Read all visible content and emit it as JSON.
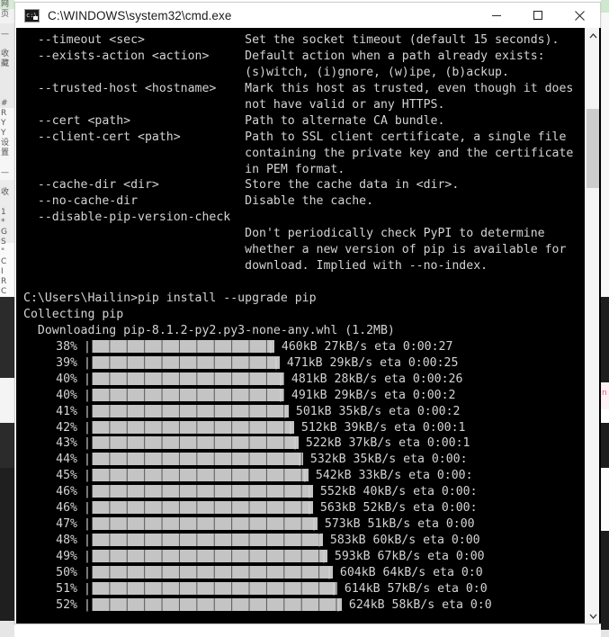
{
  "window": {
    "title": "C:\\WINDOWS\\system32\\cmd.exe",
    "icon": "cmd-console-icon",
    "minimize_label": "─",
    "maximize_label": "□",
    "close_label": "✕",
    "background": "#000000",
    "foreground": "#d4d4d4",
    "titlebar_background": "#ffffff"
  },
  "terminal": {
    "help_lines": [
      {
        "option": "--timeout <sec>",
        "desc": "Set the socket timeout (default 15 seconds)."
      },
      {
        "option": "--exists-action <action>",
        "desc": "Default action when a path already exists:"
      },
      {
        "option": "",
        "desc": "(s)witch, (i)gnore, (w)ipe, (b)ackup."
      },
      {
        "option": "--trusted-host <hostname>",
        "desc": "Mark this host as trusted, even though it does"
      },
      {
        "option": "",
        "desc": "not have valid or any HTTPS."
      },
      {
        "option": "--cert <path>",
        "desc": "Path to alternate CA bundle."
      },
      {
        "option": "--client-cert <path>",
        "desc": "Path to SSL client certificate, a single file"
      },
      {
        "option": "",
        "desc": "containing the private key and the certificate"
      },
      {
        "option": "",
        "desc": "in PEM format."
      },
      {
        "option": "--cache-dir <dir>",
        "desc": "Store the cache data in <dir>."
      },
      {
        "option": "--no-cache-dir",
        "desc": "Disable the cache."
      },
      {
        "option": "--disable-pip-version-check",
        "desc": ""
      },
      {
        "option": "",
        "desc": "Don't periodically check PyPI to determine"
      },
      {
        "option": "",
        "desc": "whether a new version of pip is available for"
      },
      {
        "option": "",
        "desc": "download. Implied with --no-index."
      }
    ],
    "prompt": "C:\\Users\\Hailin>",
    "command": "pip install --upgrade pip",
    "collecting_line": "Collecting pip",
    "downloading_line": "  Downloading pip-8.1.2-py2.py3-none-any.whl (1.2MB)",
    "progress_rows": [
      {
        "percent": "38%",
        "downloaded": "460kB",
        "rate": "27kB/s",
        "eta_label": "eta",
        "eta": "0:00:27"
      },
      {
        "percent": "39%",
        "downloaded": "471kB",
        "rate": "29kB/s",
        "eta_label": "eta",
        "eta": "0:00:25"
      },
      {
        "percent": "40%",
        "downloaded": "481kB",
        "rate": "28kB/s",
        "eta_label": "eta",
        "eta": "0:00:26"
      },
      {
        "percent": "40%",
        "downloaded": "491kB",
        "rate": "29kB/s",
        "eta_label": "eta",
        "eta": "0:00:2"
      },
      {
        "percent": "41%",
        "downloaded": "501kB",
        "rate": "35kB/s",
        "eta_label": "eta",
        "eta": "0:00:2"
      },
      {
        "percent": "42%",
        "downloaded": "512kB",
        "rate": "39kB/s",
        "eta_label": "eta",
        "eta": "0:00:1"
      },
      {
        "percent": "43%",
        "downloaded": "522kB",
        "rate": "37kB/s",
        "eta_label": "eta",
        "eta": "0:00:1"
      },
      {
        "percent": "44%",
        "downloaded": "532kB",
        "rate": "35kB/s",
        "eta_label": "eta",
        "eta": "0:00:"
      },
      {
        "percent": "45%",
        "downloaded": "542kB",
        "rate": "33kB/s",
        "eta_label": "eta",
        "eta": "0:00:"
      },
      {
        "percent": "46%",
        "downloaded": "552kB",
        "rate": "40kB/s",
        "eta_label": "eta",
        "eta": "0:00:"
      },
      {
        "percent": "46%",
        "downloaded": "563kB",
        "rate": "52kB/s",
        "eta_label": "eta",
        "eta": "0:00:"
      },
      {
        "percent": "47%",
        "downloaded": "573kB",
        "rate": "51kB/s",
        "eta_label": "eta",
        "eta": "0:00"
      },
      {
        "percent": "48%",
        "downloaded": "583kB",
        "rate": "60kB/s",
        "eta_label": "eta",
        "eta": "0:00"
      },
      {
        "percent": "49%",
        "downloaded": "593kB",
        "rate": "67kB/s",
        "eta_label": "eta",
        "eta": "0:00"
      },
      {
        "percent": "50%",
        "downloaded": "604kB",
        "rate": "64kB/s",
        "eta_label": "eta",
        "eta": "0:0"
      },
      {
        "percent": "51%",
        "downloaded": "614kB",
        "rate": "57kB/s",
        "eta_label": "eta",
        "eta": "0:0"
      },
      {
        "percent": "52%",
        "downloaded": "624kB",
        "rate": "58kB/s",
        "eta_label": "eta",
        "eta": "0:0"
      }
    ]
  },
  "scrollbar": {
    "up_arrow": "∧",
    "down_arrow": "∨",
    "thumb_color": "#cdcdcd",
    "track_color": "#f4f4f4"
  },
  "desktop": {
    "left_strip_glyphs": "网\n页\n\n—\n\n收\n藏\n\n\n\n#\nR\nY\nY\n设\n置\n\n—\n\n收\n\n1\n*\nG\nS\n\"\nC\nI\nR\nC",
    "right_mark": "n"
  }
}
